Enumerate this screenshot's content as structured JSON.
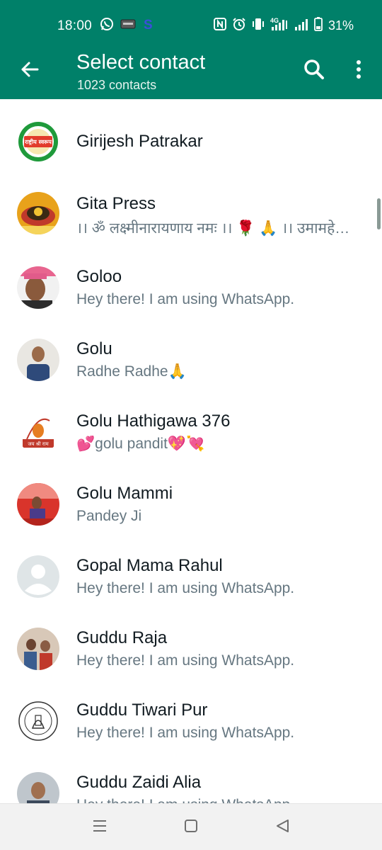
{
  "status_bar": {
    "time": "18:00",
    "battery_text": "31%",
    "left_icons": [
      "whatsapp-icon",
      "app-notification-icon",
      "skype-icon"
    ],
    "right_icons": [
      "nfc-icon",
      "alarm-icon",
      "vibrate-icon",
      "network-4g-signal-icon",
      "signal-icon",
      "battery-icon"
    ]
  },
  "app_bar": {
    "title": "Select contact",
    "subtitle": "1023 contacts",
    "back_icon": "arrow-left-icon",
    "search_icon": "search-icon",
    "more_icon": "more-vertical-icon",
    "accent_color": "#008069"
  },
  "contacts": [
    {
      "name": "Girijesh Patrakar",
      "status": ""
    },
    {
      "name": "Gita Press",
      "status": "।। ॐ लक्ष्मीनारायणाय नमः ।। 🌹 🙏 ।। उमामहे…"
    },
    {
      "name": "Goloo",
      "status": "Hey there! I am using WhatsApp."
    },
    {
      "name": "Golu",
      "status": "Radhe Radhe🙏"
    },
    {
      "name": "Golu Hathigawa 376",
      "status": "💕golu pandit💖💘"
    },
    {
      "name": "Golu Mammi",
      "status": "Pandey Ji"
    },
    {
      "name": "Gopal Mama Rahul",
      "status": "Hey there! I am using WhatsApp."
    },
    {
      "name": "Guddu Raja",
      "status": "Hey there! I am using WhatsApp."
    },
    {
      "name": "Guddu Tiwari Pur",
      "status": "Hey there! I am using WhatsApp."
    },
    {
      "name": "Guddu Zaidi Alia",
      "status": "Hey there! I am using WhatsApp."
    }
  ],
  "avatar_logo_text": {
    "girijesh": "राष्ट्रीय स्वरूप",
    "golu_hathigawa": "जय श्री राम"
  },
  "nav_bar": {
    "icons": [
      "recents-icon",
      "home-icon",
      "back-icon"
    ]
  }
}
